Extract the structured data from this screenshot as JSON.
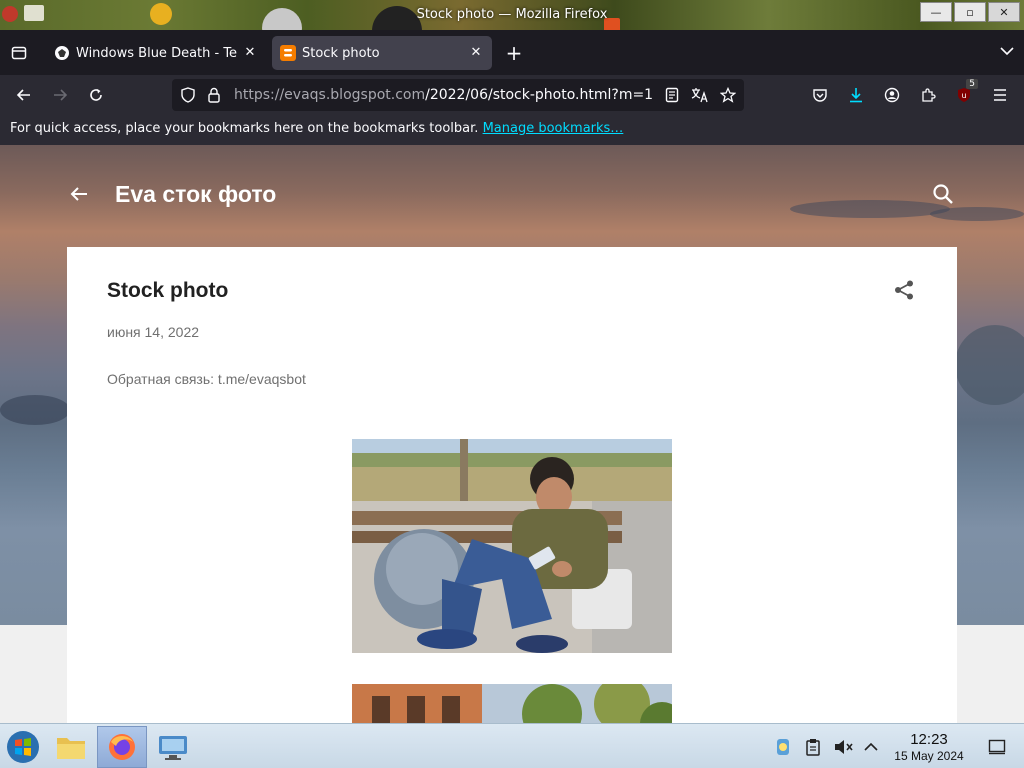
{
  "window": {
    "title": "Stock photo — Mozilla Firefox",
    "minimize_label": "—",
    "maximize_label": "▫",
    "close_label": "✕"
  },
  "tabs": [
    {
      "label": "Windows Blue Death - Te",
      "active": false,
      "close": "✕"
    },
    {
      "label": "Stock photo",
      "active": true,
      "close": "✕"
    }
  ],
  "new_tab_label": "+",
  "navbar": {
    "url_host": "https://evaqs.blogspot.com",
    "url_path": "/2022/06/stock-photo.html?m=1",
    "extension_badge": "5"
  },
  "bookmarks_bar": {
    "message": "For quick access, place your bookmarks here on the bookmarks toolbar.",
    "link": "Manage bookmarks…"
  },
  "blog": {
    "title": "Eva сток фото",
    "post_title": "Stock photo",
    "post_date": "июня 14, 2022",
    "post_text": "Обратная связь: t.me/evaqsbot"
  },
  "taskbar": {
    "time": "12:23",
    "date": "15 May 2024"
  },
  "colors": {
    "browser_bg": "#1c1b22",
    "toolbar_bg": "#2b2a33",
    "active_tab": "#42414d",
    "link": "#00ddff",
    "blogger_orange": "#f57d00"
  }
}
